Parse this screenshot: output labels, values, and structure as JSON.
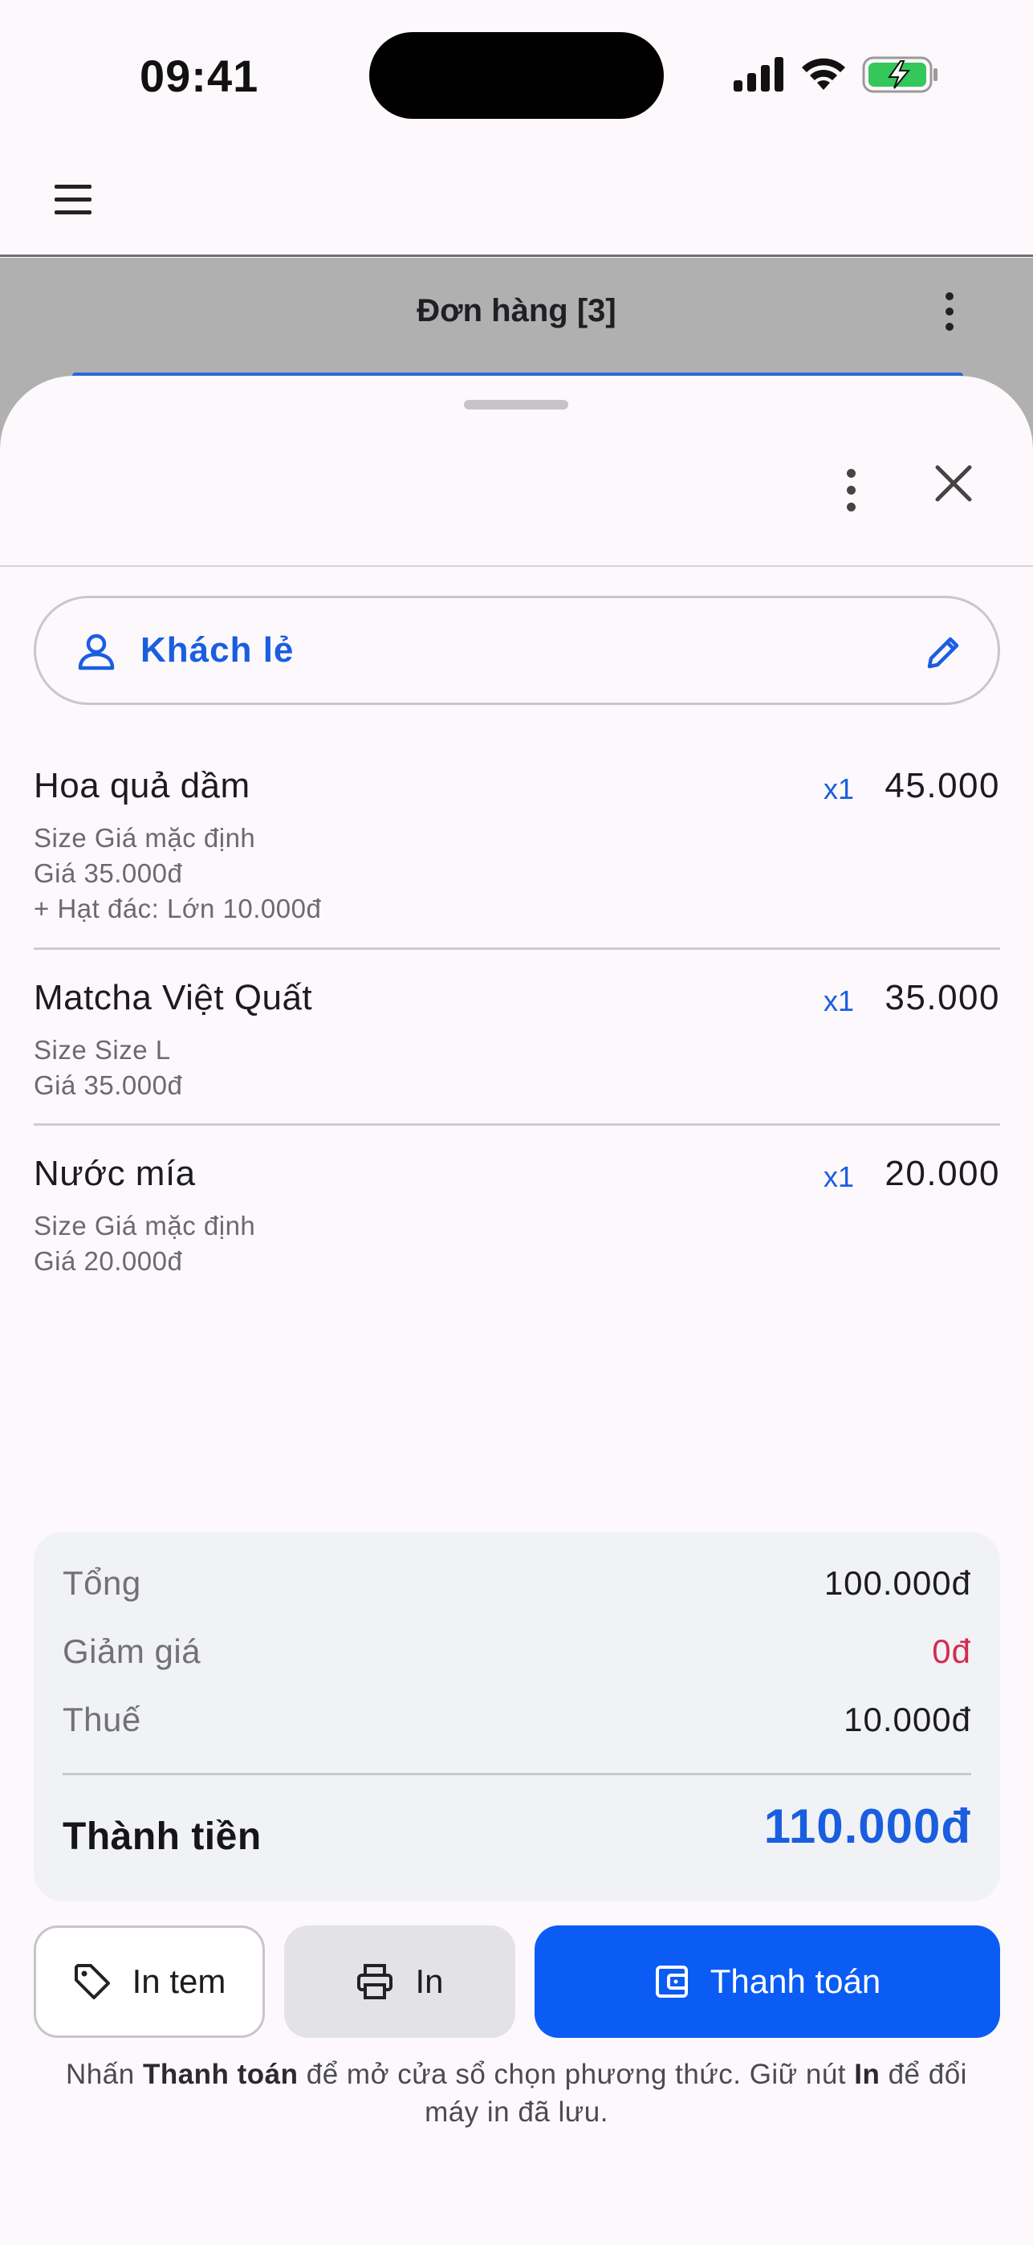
{
  "status_bar": {
    "time": "09:41"
  },
  "app_bar": {
    "menu_icon": "hamburger-menu-icon"
  },
  "behind": {
    "title": "Đơn hàng [3]"
  },
  "sheet": {
    "customer": {
      "name": "Khách lẻ",
      "icon": "person-icon",
      "edit_icon": "pencil-icon"
    },
    "items": [
      {
        "name": "Hoa quả dầm",
        "qty": "x1",
        "price": "45.000",
        "details": [
          "Size Giá mặc định",
          "Giá 35.000đ",
          "+ Hạt đác: Lớn 10.000đ"
        ]
      },
      {
        "name": "Matcha Việt Quất",
        "qty": "x1",
        "price": "35.000",
        "details": [
          "Size Size L",
          "Giá 35.000đ"
        ]
      },
      {
        "name": "Nước mía",
        "qty": "x1",
        "price": "20.000",
        "details": [
          "Size Giá mặc định",
          "Giá 20.000đ"
        ]
      }
    ],
    "summary": {
      "subtotal_label": "Tổng",
      "subtotal_value": "100.000đ",
      "discount_label": "Giảm giá",
      "discount_value": "0đ",
      "tax_label": "Thuế",
      "tax_value": "10.000đ",
      "total_label": "Thành tiền",
      "total_value": "110.000đ"
    },
    "buttons": {
      "print_label": "In tem",
      "print_receipt": "In",
      "pay": "Thanh toán"
    },
    "hint": {
      "p1": "Nhấn ",
      "b1": "Thanh toán",
      "p2": " để mở cửa sổ chọn phương thức. Giữ nút ",
      "b2": "In",
      "p3": " để đổi máy in đã lưu."
    }
  },
  "colors": {
    "accent": "#0a5cf5",
    "link": "#1a5ee0",
    "discount": "#d42a4f",
    "scrim": "#b0b0b0"
  }
}
